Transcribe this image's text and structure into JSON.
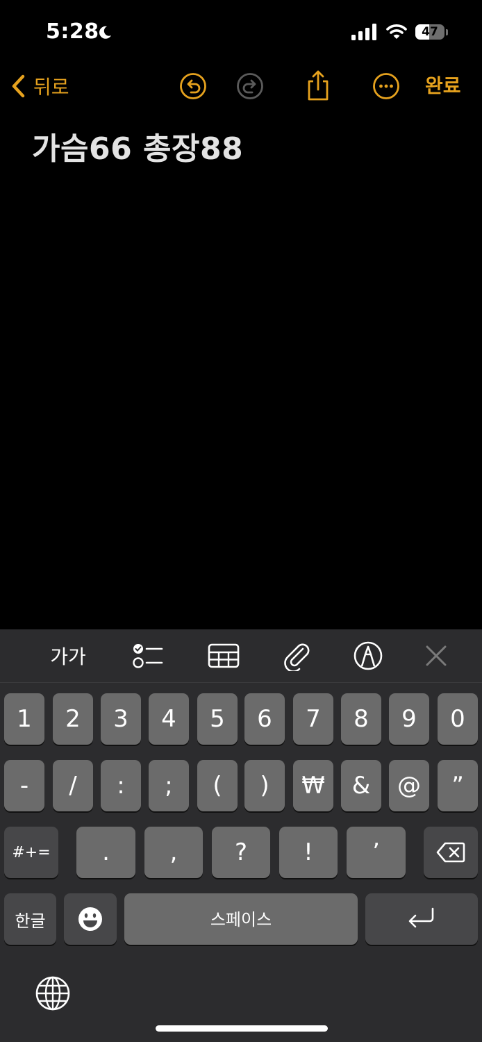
{
  "status_bar": {
    "time": "5:28",
    "battery_level": "47",
    "battery_fraction": 0.47
  },
  "nav": {
    "back_label": "뒤로",
    "done_label": "완료",
    "accent": "#e6a21e",
    "icons": [
      "chevron-left-icon",
      "undo-icon",
      "redo-icon",
      "share-icon",
      "more-icon"
    ]
  },
  "note": {
    "title": "가슴66 총장88"
  },
  "toolbar": {
    "format_label": "가가",
    "icons": [
      "checklist-icon",
      "table-icon",
      "attachment-icon",
      "markup-icon",
      "close-icon"
    ]
  },
  "keyboard": {
    "row1": [
      "1",
      "2",
      "3",
      "4",
      "5",
      "6",
      "7",
      "8",
      "9",
      "0"
    ],
    "row2": [
      "-",
      "/",
      ":",
      ";",
      "(",
      ")",
      "₩",
      "&",
      "@",
      "”"
    ],
    "row3_mode": "#+=",
    "row3": [
      ".",
      ",",
      "?",
      "!",
      "’"
    ],
    "lang_key": "한글",
    "space_key": "스페이스",
    "icons": [
      "emoji-icon",
      "delete-icon",
      "return-icon",
      "globe-icon"
    ]
  }
}
